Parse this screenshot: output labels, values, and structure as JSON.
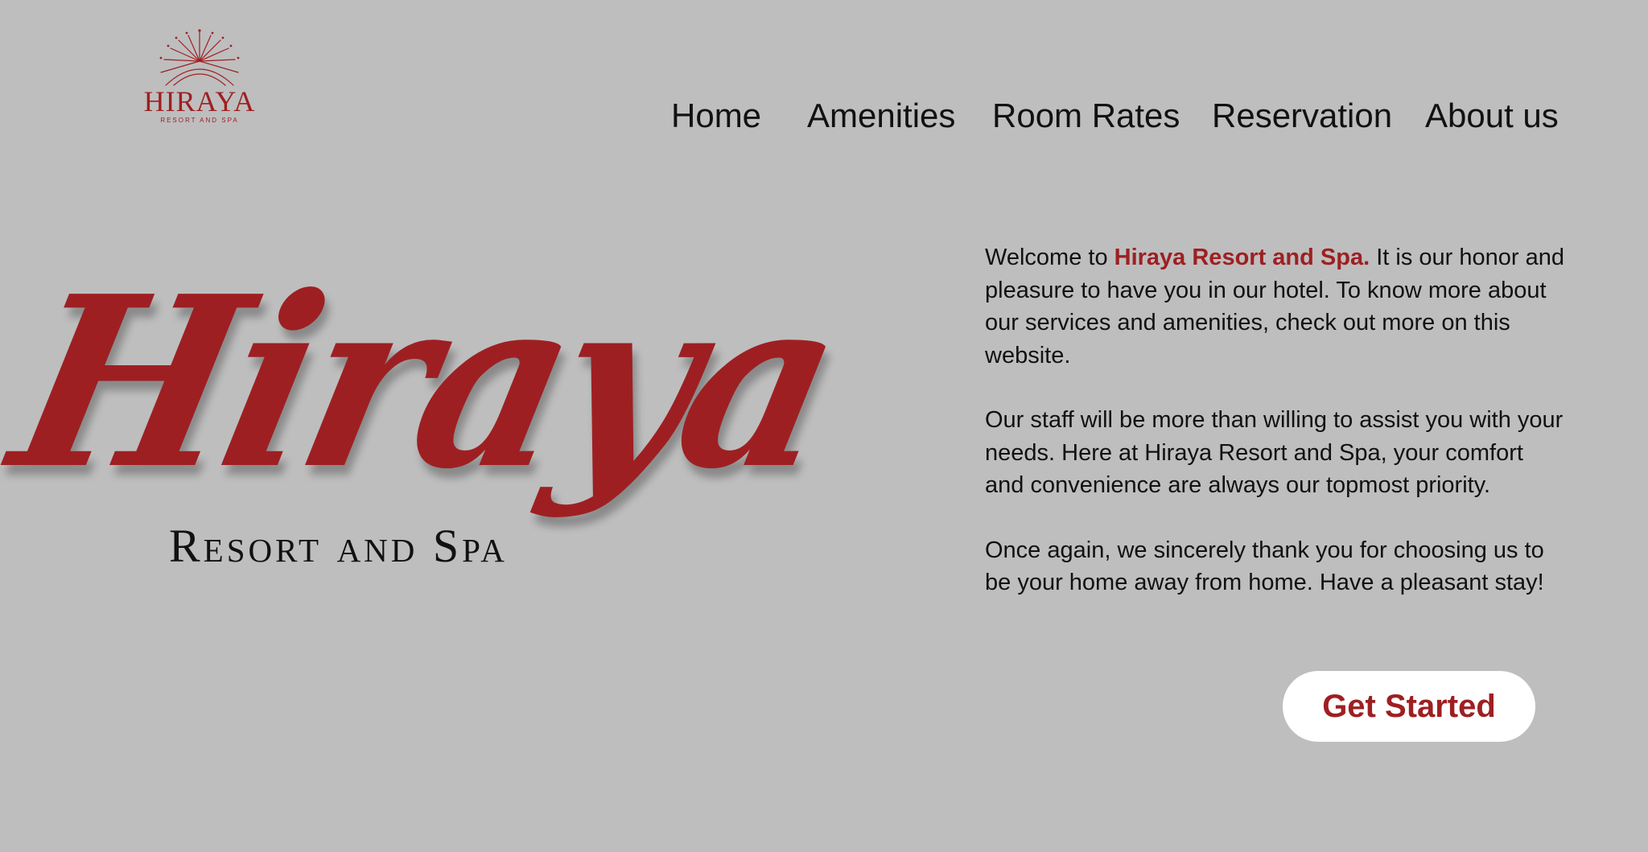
{
  "header": {
    "logo": {
      "wordmark": "HIRAYA",
      "subtitle": "RESORT AND SPA",
      "icon": "sunburst-icon"
    },
    "nav": {
      "items": [
        {
          "label": "Home"
        },
        {
          "label": "Amenities"
        },
        {
          "label": "Room Rates"
        },
        {
          "label": "Reservation"
        },
        {
          "label": "About us"
        }
      ]
    }
  },
  "hero": {
    "title": "Hiraya",
    "tagline": "Resort and Spa"
  },
  "intro": {
    "p1_prefix": "Welcome to",
    "p1_highlight": "Hiraya Resort and Spa.",
    "p1_suffix": "It is our honor and pleasure to have you in our hotel. To know more about our services and amenities, check out more on this website.",
    "p2": "Our staff will be more than willing to assist you with your needs. Here at Hiraya Resort and Spa, your comfort and convenience are always our topmost priority.",
    "p3": "Once again, we sincerely thank you for choosing us to be your home away from home. Have a pleasant stay!"
  },
  "cta": {
    "label": "Get Started"
  },
  "colors": {
    "background": "#bebebe",
    "accent": "#9e1f22",
    "text": "#111111",
    "button_bg": "#ffffff"
  }
}
